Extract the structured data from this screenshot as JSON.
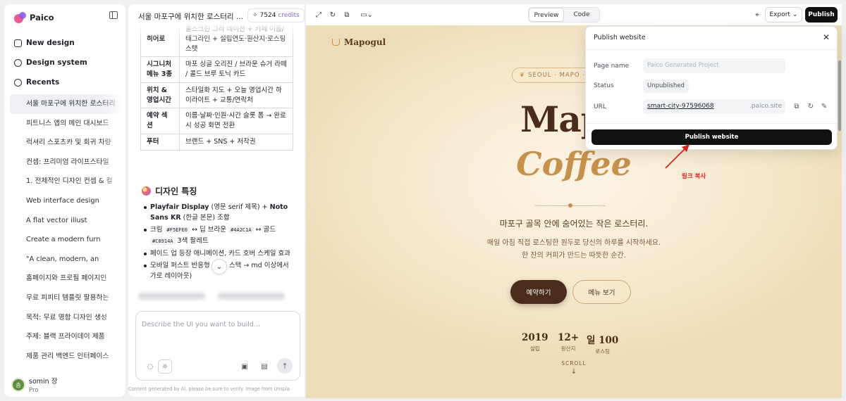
{
  "app": {
    "name": "Paico"
  },
  "sidebar": {
    "new_design": "New design",
    "design_system": "Design system",
    "recents_label": "Recents",
    "recents": [
      "서울 마포구에 위치한 로스터리",
      "피트니스 앱의 메인 대시보드",
      "럭셔리 스포츠카 및 회귀 차량",
      "컨셉: 프리미엄 라이프스타일",
      "1. 전체적인 디자인 컨셉 & 컬",
      "Web interface design",
      "A flat vector illust",
      "Create a modern furn",
      "\"A clean, modern, an",
      "홈페이지와 프로필 페이지인",
      "무료 피피티 템플릿 팔용하는",
      "목적: 무료 명함 디자인 생성",
      "주제: 블랙 프라이데이 제품",
      "제품 관리 백엔드 인터페이스"
    ],
    "user": {
      "name": "somin 장",
      "plan": "Pro",
      "initial": "솜"
    }
  },
  "chat": {
    "title": "서울 마포구에 위치한 로스터리 ...",
    "credits": {
      "value": "7524",
      "label": "credits"
    },
    "table": [
      {
        "key": "히어로",
        "value": "풀스크린 그라 데이션 + 카페 이름/태그라인 + 설립연도·원산지·로스팅 스탯"
      },
      {
        "key": "시그니처 메뉴 3종",
        "value": "마포 싱글 오리진 / 브라운 슈거 라떼 / 콜드 브루 토닉 카드"
      },
      {
        "key": "위치 & 영업시간",
        "value": "스타일화 지도 + 오늘 영업시간 하이라이트 + 교통/연락처"
      },
      {
        "key": "예약 섹션",
        "value": "이름·날짜·인원·시간 슬롯 폼 → 완료 시 성공 화면 전환"
      },
      {
        "key": "푸터",
        "value": "브랜드 + SNS + 저작권"
      }
    ],
    "section_title": "디자인 특징",
    "bullets": {
      "b1_font1": "Playfair Display",
      "b1_mid": " (영문 serif 제목) + ",
      "b1_font2": "Noto Sans KR",
      "b1_end": " (한글 본문) 조합",
      "b2_cream": "크림",
      "b2_c1": "#F5EFE0",
      "b2_brown": "↔ 딥 브라운",
      "b2_c2": "#4A2C1A",
      "b2_gold": "↔ 골드",
      "b2_c3": "#C8914A",
      "b2_end": "3색 팔레트",
      "b3": "페이드 업 등장 애니메이션, 카드 호버 스케일 효과",
      "b4": "모바일 퍼스트 반응형 (세로 스택 → md 이상에서 가로 레이아웃)"
    },
    "input_placeholder": "Describe the UI you want to build...",
    "disclaimer": "Content generated by AI, please be sure to verify. Image from Unspla"
  },
  "toolbar": {
    "tabs": [
      "Preview",
      "Code"
    ],
    "active_tab": "Preview",
    "export": "Export",
    "publish": "Publish"
  },
  "preview": {
    "logo": "Mapogul",
    "badge": "SEOUL · MAPO · RO",
    "hero_line1": "Mapo",
    "hero_line2": "Coffee",
    "tagline": "마포구 골목 안에 숨어있는 작은 로스터리.",
    "desc_line1": "매일 아침 직접 로스팅한 원두로 당신의 하루를 시작하세요.",
    "desc_line2": "한 잔의 커피가 만드는 따뜻한 순간.",
    "cta_primary": "예약하기",
    "cta_secondary": "메뉴 보기",
    "stats": [
      {
        "value": "2019",
        "label": "설립"
      },
      {
        "value": "12+",
        "label": "원산지"
      },
      {
        "value": "일 100",
        "label": "로스팅"
      }
    ],
    "scroll": "SCROLL",
    "colors": {
      "cream": "#F5EFE0",
      "brown": "#4A2C1A",
      "gold": "#C8914A"
    }
  },
  "publish_dialog": {
    "title": "Publish website",
    "page_name_label": "Page name",
    "page_name_placeholder": "Paico Generated Project",
    "status_label": "Status",
    "status_value": "Unpublished",
    "url_label": "URL",
    "url_subdomain": "smart-city-97596068",
    "url_domain": ".paico.site",
    "publish_button": "Publish website"
  },
  "annotation": {
    "text": "링크 복사",
    "color": "#e02020"
  }
}
